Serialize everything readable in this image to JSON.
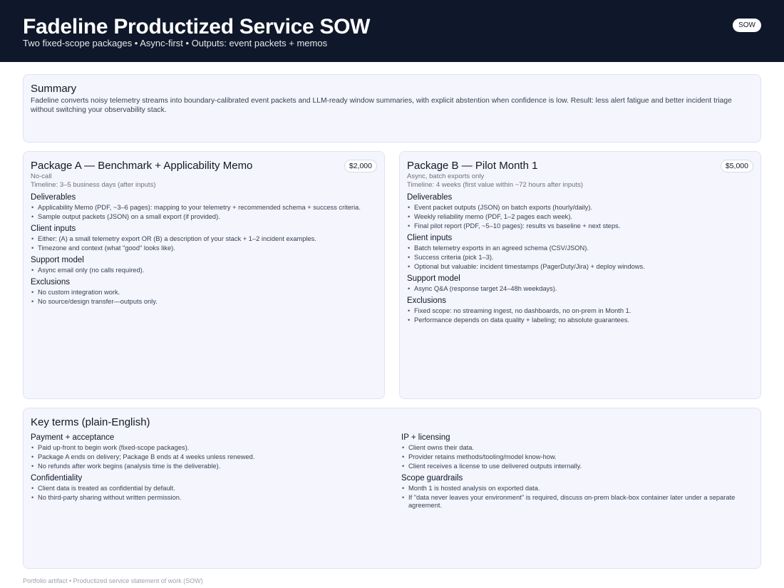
{
  "header": {
    "title": "Fadeline Productized Service SOW",
    "subtitle": "Two fixed-scope packages • Async-first • Outputs: event packets + memos",
    "badge": "SOW"
  },
  "summary": {
    "title": "Summary",
    "text": "Fadeline converts noisy telemetry streams into boundary-calibrated event packets and LLM-ready window summaries, with explicit abstention when confidence is low. Result: less alert fatigue and better incident triage without switching your observability stack."
  },
  "packages": [
    {
      "title": "Package A — Benchmark + Applicability Memo",
      "price": "$2,000",
      "meta1": "No-call",
      "meta2": "Timeline: 3–5 business days (after inputs)",
      "sections": [
        {
          "title": "Deliverables",
          "items": [
            "Applicability Memo (PDF, ~3–6 pages): mapping to your telemetry + recommended schema + success criteria.",
            "Sample output packets (JSON) on a small export (if provided)."
          ]
        },
        {
          "title": "Client inputs",
          "items": [
            "Either: (A) a small telemetry export OR (B) a description of your stack + 1–2 incident examples.",
            "Timezone and context (what \"good\" looks like)."
          ]
        },
        {
          "title": "Support model",
          "items": [
            "Async email only (no calls required)."
          ]
        },
        {
          "title": "Exclusions",
          "items": [
            "No custom integration work.",
            "No source/design transfer—outputs only."
          ]
        }
      ]
    },
    {
      "title": "Package B — Pilot Month 1",
      "price": "$5,000",
      "meta1": "Async, batch exports only",
      "meta2": "Timeline: 4 weeks (first value within ~72 hours after inputs)",
      "sections": [
        {
          "title": "Deliverables",
          "items": [
            "Event packet outputs (JSON) on batch exports (hourly/daily).",
            "Weekly reliability memo (PDF, 1–2 pages each week).",
            "Final pilot report (PDF, ~5–10 pages): results vs baseline + next steps."
          ]
        },
        {
          "title": "Client inputs",
          "items": [
            "Batch telemetry exports in an agreed schema (CSV/JSON).",
            "Success criteria (pick 1–3).",
            "Optional but valuable: incident timestamps (PagerDuty/Jira) + deploy windows."
          ]
        },
        {
          "title": "Support model",
          "items": [
            "Async Q&A (response target 24–48h weekdays)."
          ]
        },
        {
          "title": "Exclusions",
          "items": [
            "Fixed scope: no streaming ingest, no dashboards, no on-prem in Month 1.",
            "Performance depends on data quality + labeling; no absolute guarantees."
          ]
        }
      ]
    }
  ],
  "terms": {
    "title": "Key terms (plain-English)",
    "left": [
      {
        "title": "Payment + acceptance",
        "items": [
          "Paid up-front to begin work (fixed-scope packages).",
          "Package A ends on delivery; Package B ends at 4 weeks unless renewed.",
          "No refunds after work begins (analysis time is the deliverable)."
        ]
      },
      {
        "title": "Confidentiality",
        "items": [
          "Client data is treated as confidential by default.",
          "No third-party sharing without written permission."
        ]
      }
    ],
    "right": [
      {
        "title": "IP + licensing",
        "items": [
          "Client owns their data.",
          "Provider retains methods/tooling/model know-how.",
          "Client receives a license to use delivered outputs internally."
        ]
      },
      {
        "title": "Scope guardrails",
        "items": [
          "Month 1 is hosted analysis on exported data.",
          "If \"data never leaves your environment\" is required, discuss on-prem black-box container later under a separate agreement."
        ]
      }
    ]
  },
  "footer": "Portfolio artifact • Productized service statement of work (SOW)"
}
